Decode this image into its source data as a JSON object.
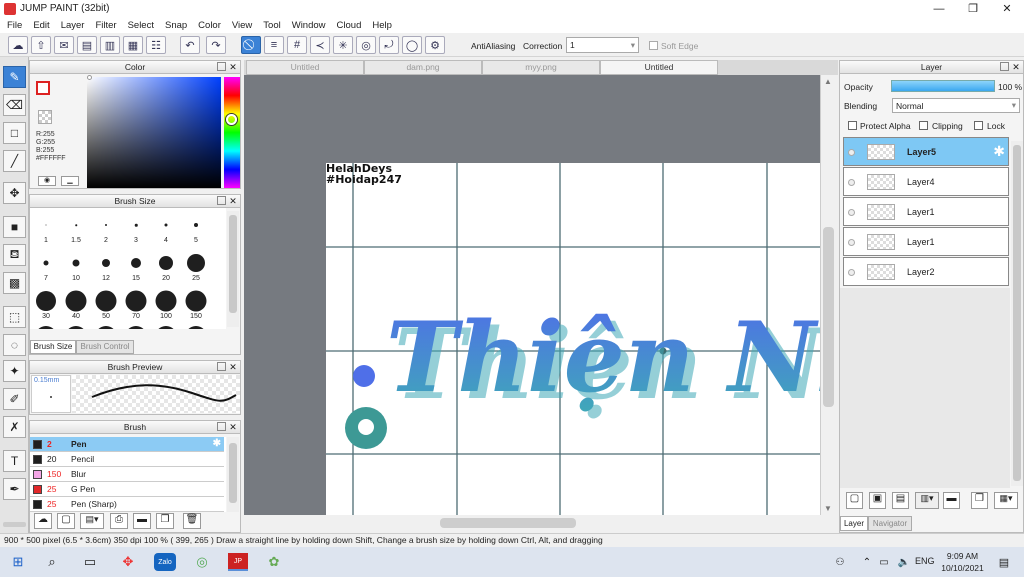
{
  "window": {
    "title": "JUMP PAINT (32bit)",
    "controls": [
      "—",
      "❐",
      "✕"
    ]
  },
  "menu": [
    "File",
    "Edit",
    "Layer",
    "Filter",
    "Select",
    "Snap",
    "Color",
    "View",
    "Tool",
    "Window",
    "Cloud",
    "Help"
  ],
  "toolbar": {
    "antialiasing_label": "AntiAliasing",
    "correction_label": "Correction",
    "correction_value": "1",
    "soft_edge_label": "Soft Edge"
  },
  "color_panel": {
    "title": "Color",
    "r": "R:255",
    "g": "G:255",
    "b": "B:255",
    "hex": "#FFFFFF"
  },
  "brush_size_panel": {
    "title": "Brush Size",
    "sizes": [
      "1",
      "1.5",
      "2",
      "3",
      "4",
      "5",
      "7",
      "10",
      "12",
      "15",
      "20",
      "25",
      "30",
      "40",
      "50",
      "70",
      "100",
      "150"
    ],
    "tabs": [
      "Brush Size",
      "Brush Control"
    ]
  },
  "brush_preview_panel": {
    "title": "Brush Preview",
    "size_value": "0.15mm"
  },
  "brush_panel": {
    "title": "Brush",
    "items": [
      {
        "size": "2",
        "name": "Pen",
        "color": "#1f1f1f"
      },
      {
        "size": "20",
        "name": "Pencil",
        "color": "#1f1f1f"
      },
      {
        "size": "150",
        "name": "Blur",
        "color": "#f4a6e6"
      },
      {
        "size": "25",
        "name": "G Pen",
        "color": "#e2282a"
      },
      {
        "size": "25",
        "name": "Pen (Sharp)",
        "color": "#1f1f1f"
      }
    ]
  },
  "document_tabs": [
    "Untitled",
    "dam.png",
    "myy.png",
    "Untitled"
  ],
  "canvas_text": {
    "line1": "HelahDeys",
    "line2": "#Hoidap247",
    "art": "Thiện Nhã"
  },
  "layer_panel": {
    "title": "Layer",
    "opacity_label": "Opacity",
    "opacity_value": "100 %",
    "blending_label": "Blending",
    "blending_value": "Normal",
    "protect_alpha": "Protect Alpha",
    "clipping": "Clipping",
    "lock": "Lock",
    "layers": [
      "Layer5",
      "Layer4",
      "Layer1",
      "Layer1",
      "Layer2"
    ],
    "tabs": [
      "Layer",
      "Navigator"
    ]
  },
  "status": "900 * 500 pixel   (6.5 * 3.6cm)   350 dpi   100 %   ( 399, 265 )   Draw a straight line by holding down Shift, Change a brush size by holding down Ctrl, Alt, and dragging",
  "taskbar": {
    "lang": "ENG",
    "time": "9:09 AM",
    "date": "10/10/2021",
    "app_zalo": "Zalo"
  },
  "colors": {
    "accent": "#3b82d6",
    "selected_row": "#7ec8f4",
    "workspace": "#767a80"
  }
}
